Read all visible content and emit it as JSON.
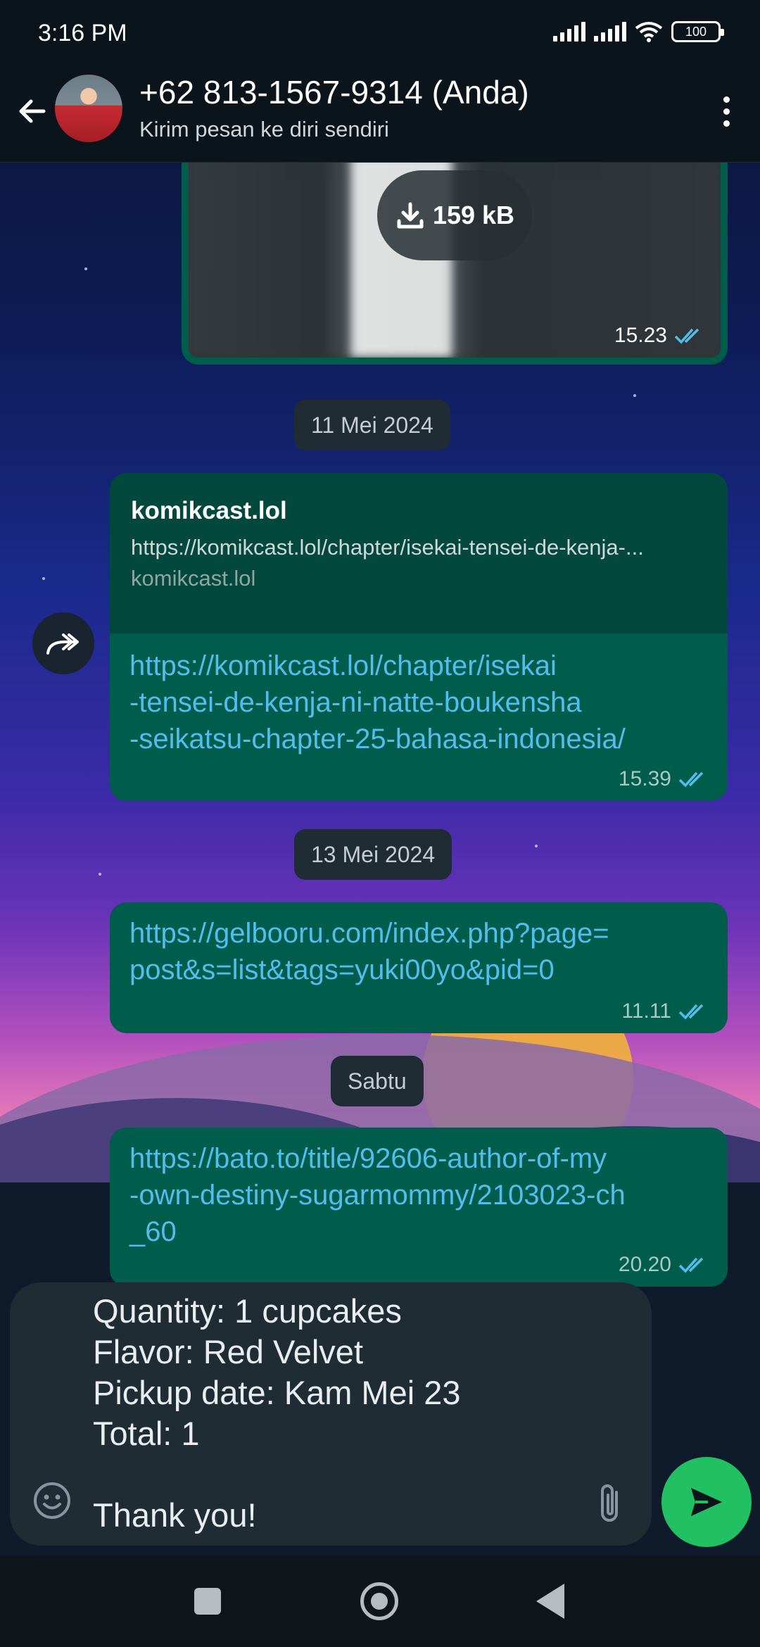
{
  "status_bar": {
    "time": "3:16 PM",
    "battery": "100"
  },
  "header": {
    "contact_name": "+62 813-1567-9314 (Anda)",
    "subtitle": "Kirim pesan ke diri sendiri",
    "icons": {
      "back": "arrow-left-icon",
      "menu": "more-vert-icon"
    }
  },
  "messages": [
    {
      "type": "image",
      "download_size": "159 kB",
      "time": "15.23",
      "status": "read"
    },
    {
      "type": "date",
      "label": "11 Mei 2024"
    },
    {
      "type": "link",
      "preview": {
        "title": "komikcast.lol",
        "url": "https://komikcast.lol/chapter/isekai-tensei-de-kenja-...",
        "domain": "komikcast.lol"
      },
      "lines": [
        "https://komikcast.lol/chapter/isekai",
        "-tensei-de-kenja-ni-natte-boukensha",
        "-seikatsu-chapter-25-bahasa-indonesia/"
      ],
      "time": "15.39",
      "status": "read"
    },
    {
      "type": "date",
      "label": "13 Mei 2024"
    },
    {
      "type": "link",
      "lines": [
        "https://gelbooru.com/index.php?page=",
        "post&s=list&tags=yuki00yo&pid=0"
      ],
      "time": "11.11",
      "status": "read"
    },
    {
      "type": "date",
      "label": "Sabtu"
    },
    {
      "type": "link",
      "lines": [
        "https://bato.to/title/92606-author-of-my",
        "-own-destiny-sugarmommy/2103023-ch",
        "_60"
      ],
      "time": "20.20",
      "status": "read"
    }
  ],
  "composer": {
    "text": "Quantity: 1 cupcakes\nFlavor: Red Velvet\nPickup date: Kam Mei 23\nTotal: 1\n\nThank you!",
    "icons": {
      "emoji": "emoji-icon",
      "attach": "paperclip-icon",
      "send": "send-icon"
    }
  },
  "colors": {
    "outgoing_bubble": "#005c4b",
    "link": "#53bdeb",
    "send_button": "#21c063",
    "app_bar": "#0b141a"
  }
}
